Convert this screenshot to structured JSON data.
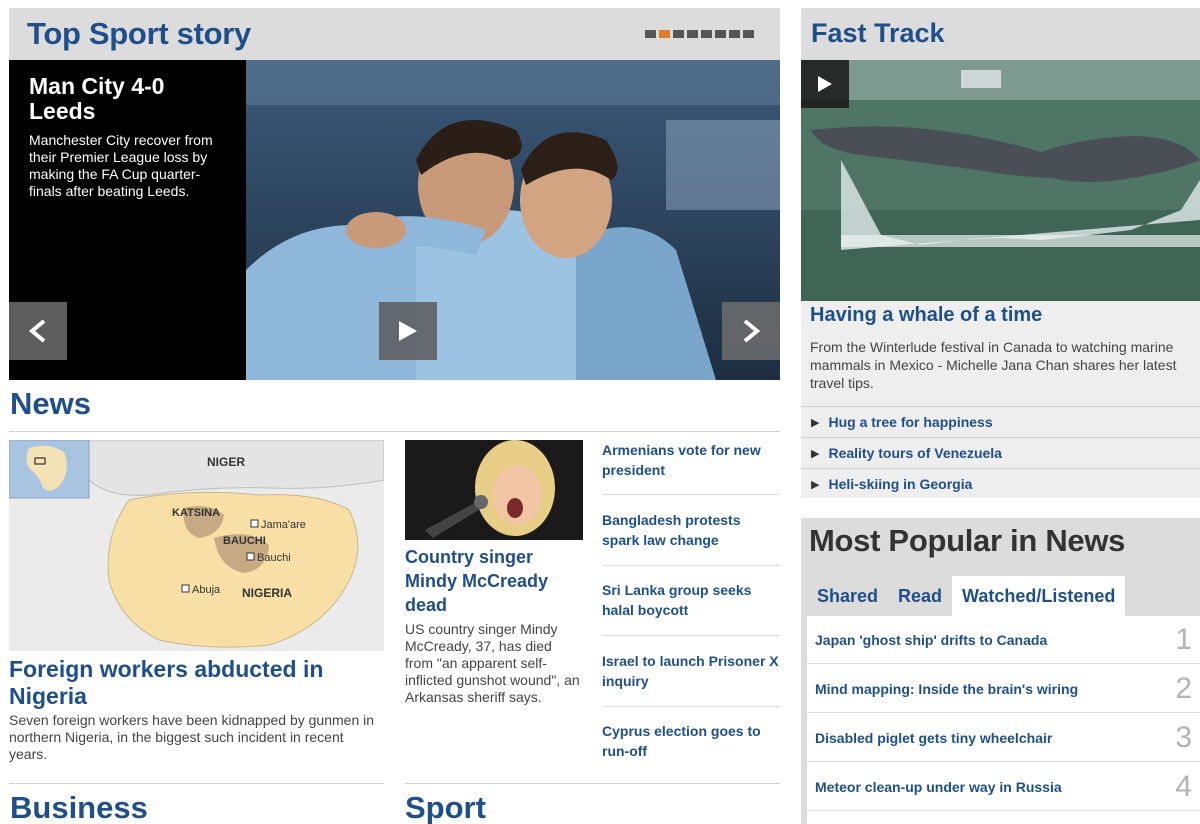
{
  "top_sport": {
    "heading": "Top Sport story",
    "carousel_total": 8,
    "carousel_active": 2,
    "story_title": "Man City 4-0 Leeds",
    "story_summary": "Manchester City recover from their Premier League loss by making the FA Cup quarter-finals after beating Leeds."
  },
  "news": {
    "heading": "News",
    "lead": {
      "map_labels": {
        "niger": "NIGER",
        "katsina": "KATSINA",
        "jamaare": "Jama'are",
        "bauchi_state": "BAUCHI",
        "bauchi_city": "Bauchi",
        "abuja": "Abuja",
        "nigeria": "NIGERIA"
      },
      "title": "Foreign workers abducted in Nigeria",
      "summary": "Seven foreign workers have been kidnapped by gunmen in northern Nigeria, in the biggest such incident in recent years."
    },
    "mid": {
      "title": "Country singer Mindy McCready dead",
      "summary": "US country singer Mindy McCready, 37, has died from \"an apparent self-inflicted gunshot wound\", an Arkansas sheriff says."
    },
    "headlines": [
      "Armenians vote for new president",
      "Bangladesh protests spark law change",
      "Sri Lanka group seeks halal boycott",
      "Israel to launch Prisoner X inquiry",
      "Cyprus election goes to run-off"
    ]
  },
  "business": {
    "heading": "Business"
  },
  "sport": {
    "heading": "Sport"
  },
  "fast_track": {
    "heading": "Fast Track",
    "title": "Having a whale of a time",
    "summary": "From the Winterlude festival in Canada to watching marine mammals in Mexico - Michelle Jana Chan shares her latest travel tips.",
    "links": [
      "Hug a tree for happiness",
      "Reality tours of Venezuela",
      "Heli-skiing in Georgia"
    ]
  },
  "most_popular": {
    "heading": "Most Popular in News",
    "tabs": [
      "Shared",
      "Read",
      "Watched/Listened"
    ],
    "active_tab": "Watched/Listened",
    "items": [
      {
        "rank": "1",
        "title": "Japan 'ghost ship' drifts to Canada"
      },
      {
        "rank": "2",
        "title": "Mind mapping: Inside the brain's wiring"
      },
      {
        "rank": "3",
        "title": "Disabled piglet gets tiny wheelchair"
      },
      {
        "rank": "4",
        "title": "Meteor clean-up under way in Russia"
      }
    ]
  },
  "colors": {
    "link_blue": "#1f4f8b",
    "accent_orange": "#e07b2c",
    "panel_grey": "#dcdcdc"
  }
}
